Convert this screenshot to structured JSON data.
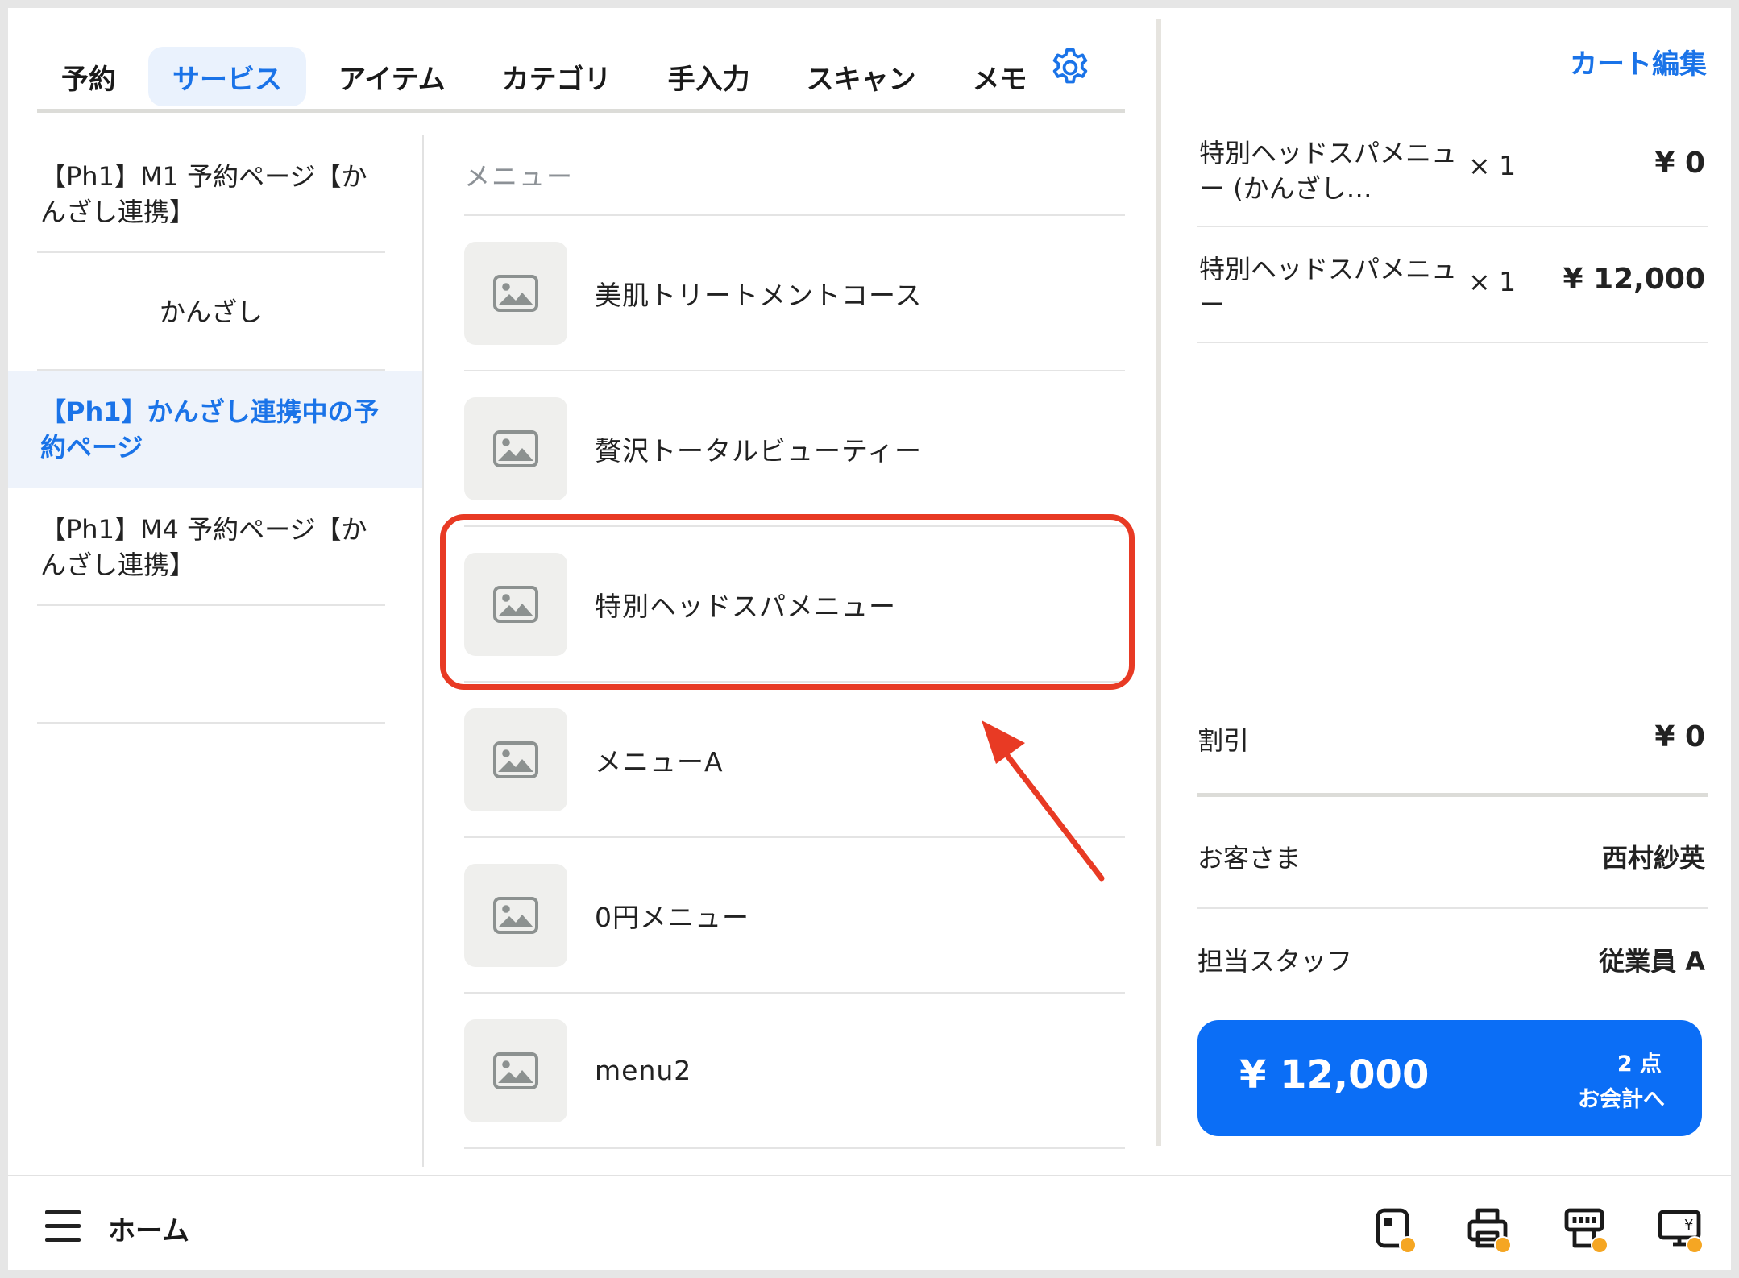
{
  "tabs": [
    {
      "label": "予約"
    },
    {
      "label": "サービス"
    },
    {
      "label": "アイテム"
    },
    {
      "label": "カテゴリ"
    },
    {
      "label": "手入力"
    },
    {
      "label": "スキャン"
    },
    {
      "label": "メモ"
    }
  ],
  "icons": {
    "settings": "gear-icon",
    "thumbnail": "image-placeholder-icon",
    "menu": "hamburger-icon"
  },
  "colors": {
    "accent": "#1a73e8",
    "checkout": "#0b6ef6",
    "highlight": "#e83a24",
    "badge": "#f5a623"
  },
  "categories": [
    {
      "label": "【Ph1】M1 予約ページ【かんざし連携】"
    },
    {
      "label": "かんざし"
    },
    {
      "label": "【Ph1】かんざし連携中の予約ページ"
    },
    {
      "label": "【Ph1】M4 予約ページ【かんざし連携】"
    }
  ],
  "menu": {
    "header": "メニュー",
    "items": [
      {
        "name": "美肌トリートメントコース"
      },
      {
        "name": "贅沢トータルビューティー"
      },
      {
        "name": "特別ヘッドスパメニュー"
      },
      {
        "name": "メニューA"
      },
      {
        "name": "0円メニュー"
      },
      {
        "name": "menu2"
      }
    ]
  },
  "cart": {
    "edit_label": "カート編集",
    "items": [
      {
        "name": "特別ヘッドスパメニュー (かんざし…",
        "qty": "× 1",
        "price": "¥ 0"
      },
      {
        "name": "特別ヘッドスパメニュー",
        "qty": "× 1",
        "price": "¥ 12,000"
      }
    ],
    "discount": {
      "label": "割引",
      "value": "¥ 0"
    },
    "customer": {
      "label": "お客さま",
      "value": "西村紗英"
    },
    "staff": {
      "label": "担当スタッフ",
      "value": "従業員 A"
    },
    "checkout": {
      "total": "¥ 12,000",
      "count": "2 点",
      "action": "お会計へ"
    }
  },
  "bottom_bar": {
    "home_label": "ホーム",
    "devices": [
      "card-reader-icon",
      "printer-icon",
      "receipt-printer-icon",
      "customer-display-icon"
    ]
  }
}
